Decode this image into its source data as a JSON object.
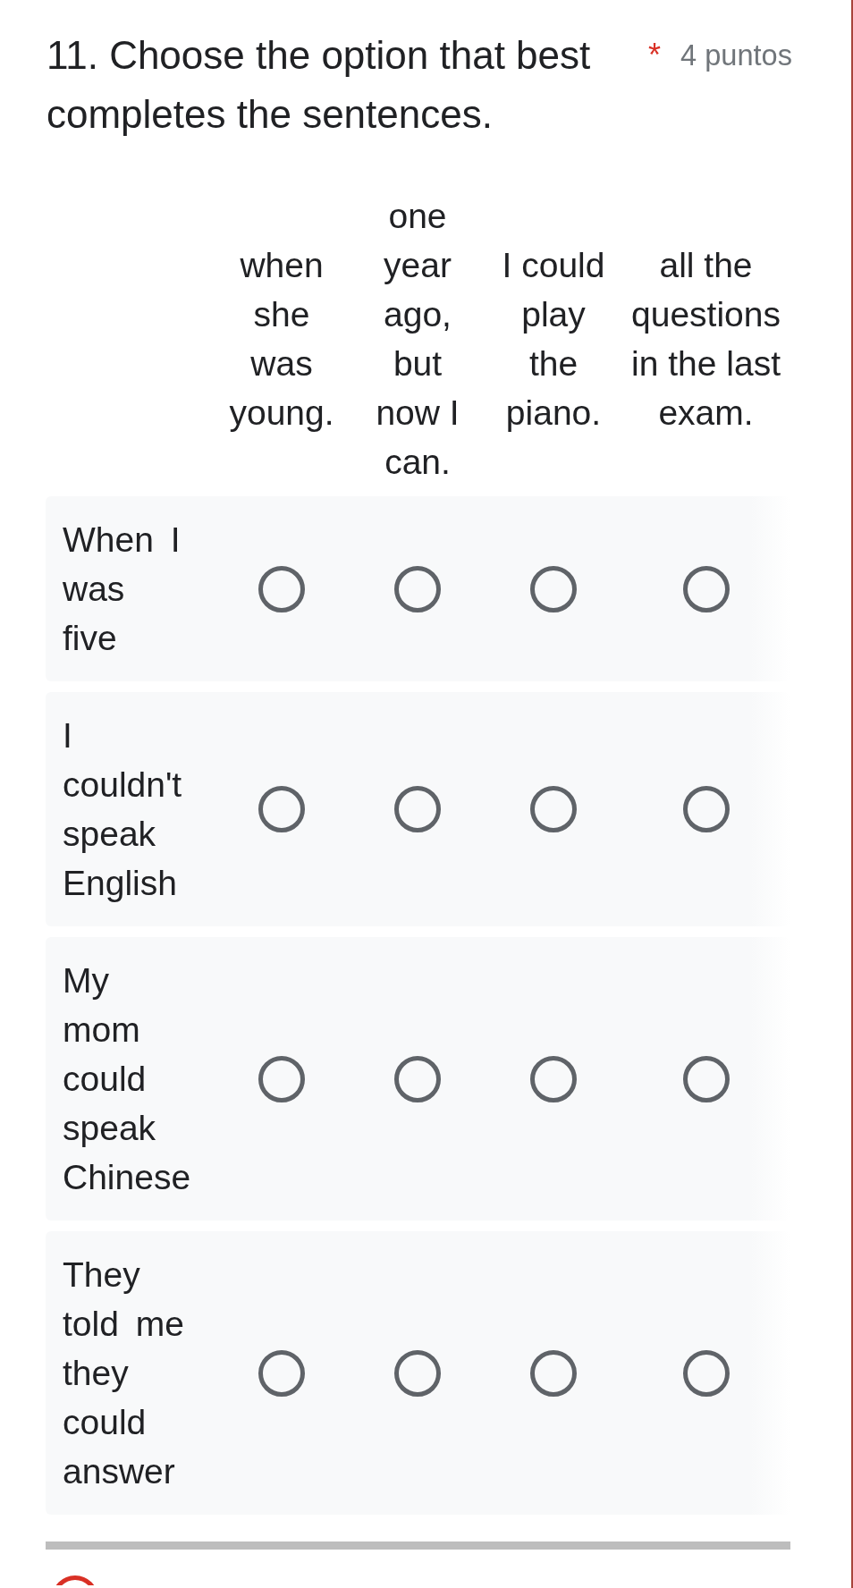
{
  "question": {
    "title": "11. Choose the option that best completes the sentences.",
    "required_mark": "*",
    "points": "4 puntos"
  },
  "grid": {
    "columns": [
      "when she was young.",
      "one year ago, but now I can.",
      "I could play the piano.",
      "all the questions in the last exam."
    ],
    "rows": [
      {
        "label": "When I was five",
        "options": [
          {
            "selected": false
          },
          {
            "selected": false
          },
          {
            "selected": false
          },
          {
            "selected": false
          }
        ]
      },
      {
        "label": "I couldn't speak English",
        "options": [
          {
            "selected": false
          },
          {
            "selected": false
          },
          {
            "selected": false
          },
          {
            "selected": false
          }
        ]
      },
      {
        "label": "My mom could speak Chinese",
        "options": [
          {
            "selected": false
          },
          {
            "selected": false
          },
          {
            "selected": false
          },
          {
            "selected": false
          }
        ]
      },
      {
        "label": "They told me they could answer",
        "options": [
          {
            "selected": false
          },
          {
            "selected": false
          },
          {
            "selected": false
          },
          {
            "selected": false
          }
        ]
      }
    ]
  }
}
